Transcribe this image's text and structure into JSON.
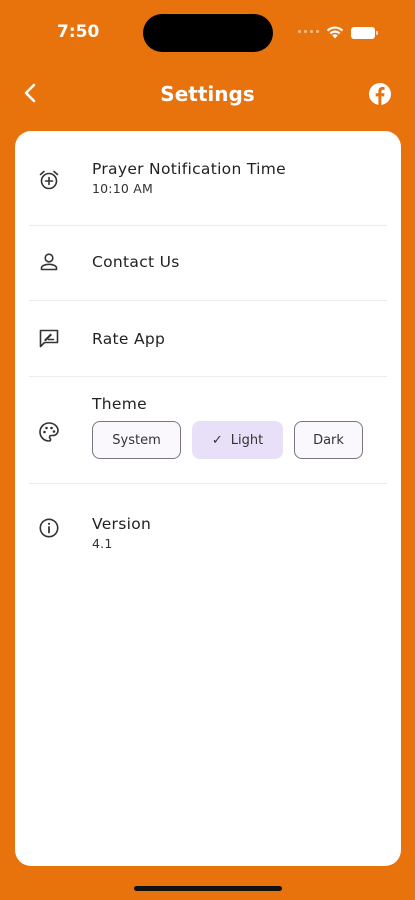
{
  "status_bar": {
    "time": "7:50"
  },
  "header": {
    "title": "Settings"
  },
  "settings": {
    "notification": {
      "title": "Prayer Notification Time",
      "value": "10:10 AM"
    },
    "contact": {
      "title": "Contact Us"
    },
    "rate": {
      "title": "Rate App"
    },
    "theme": {
      "title": "Theme",
      "options": [
        "System",
        "Light",
        "Dark"
      ],
      "selected": "Light"
    },
    "version": {
      "title": "Version",
      "value": "4.1"
    }
  },
  "icons": {
    "back": "chevron-left-icon",
    "facebook": "facebook-icon",
    "notification": "alarm-add-icon",
    "contact": "person-icon",
    "rate": "rate-review-icon",
    "theme": "palette-icon",
    "version": "info-icon",
    "check": "check-icon"
  },
  "colors": {
    "background": "#E8720C",
    "card": "#FFFFFF",
    "selected_chip": "#E8DFF8"
  }
}
